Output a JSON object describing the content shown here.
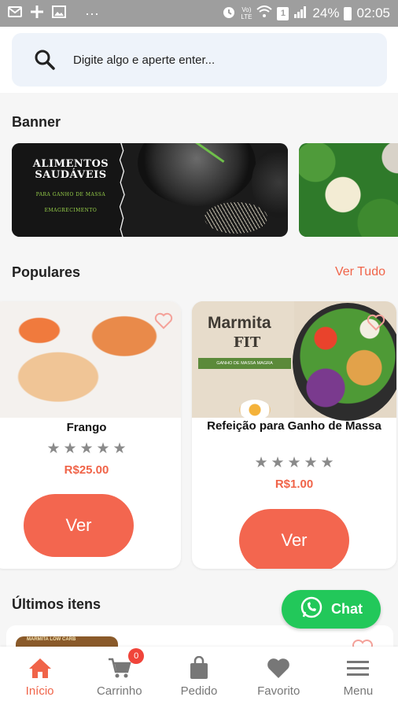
{
  "status_bar": {
    "dots": "···",
    "volte_top": "Vo)",
    "volte_bottom": "LTE",
    "sim": "1",
    "battery": "24%",
    "time": "02:05"
  },
  "search": {
    "placeholder": "Digite algo e aperte enter..."
  },
  "sections": {
    "banner_title": "Banner",
    "popular_title": "Populares",
    "popular_link": "Ver Tudo",
    "last_title": "Últimos itens"
  },
  "banners": [
    {
      "title": "ALIMENTOS SAUDÁVEIS",
      "line1": "PARA GANHO DE MASSA",
      "line2": "EMAGRECIMENTO"
    },
    {}
  ],
  "products": [
    {
      "name": "Frango",
      "rating": 0,
      "max_rating": 5,
      "price": "R$25.00",
      "button": "Ver"
    },
    {
      "name": "Refeição para Ganho de Massa",
      "rating": 0,
      "max_rating": 5,
      "price": "R$1.00",
      "button": "Ver",
      "image_title": "Marmita",
      "image_subtitle": "FIT",
      "image_ribbon": "GANHO DE MASSA MAGRA"
    }
  ],
  "last_items": [
    {
      "thumb_text": "MARMITA LOW CARB"
    }
  ],
  "chat": {
    "label": "Chat"
  },
  "bottom_nav": [
    {
      "label": "Início",
      "icon": "home-icon",
      "active": true
    },
    {
      "label": "Carrinho",
      "icon": "cart-icon",
      "badge": "0"
    },
    {
      "label": "Pedido",
      "icon": "bag-icon"
    },
    {
      "label": "Favorito",
      "icon": "heart-icon"
    },
    {
      "label": "Menu",
      "icon": "menu-icon"
    }
  ],
  "colors": {
    "accent": "#f06449",
    "button": "#f3664f",
    "chat": "#22c85a",
    "status_bar": "#9e9e9e",
    "star": "#8a8a8a"
  }
}
